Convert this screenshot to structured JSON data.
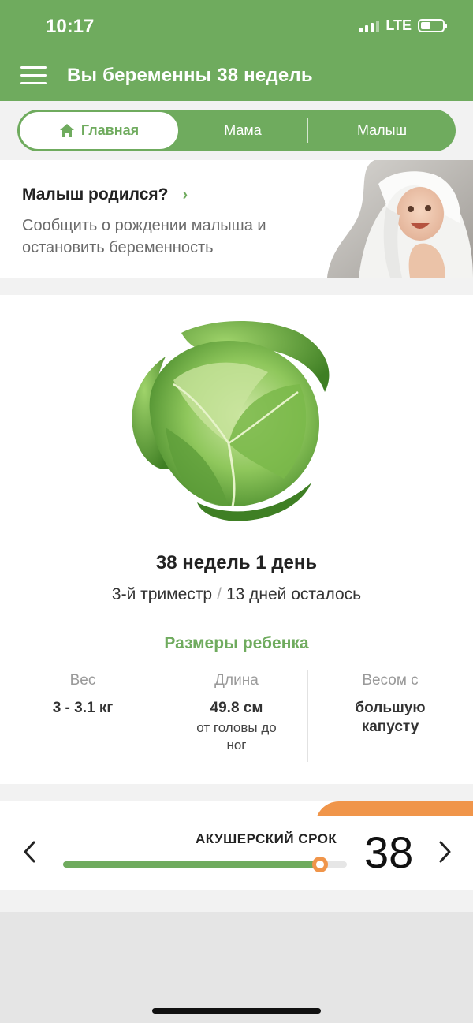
{
  "status": {
    "time": "10:17",
    "network": "LTE"
  },
  "header": {
    "title": "Вы беременны 38 недель"
  },
  "tabs": [
    {
      "label": "Главная",
      "active": true
    },
    {
      "label": "Мама",
      "active": false
    },
    {
      "label": "Малыш",
      "active": false
    }
  ],
  "born_card": {
    "title": "Малыш родился?",
    "subtitle": "Сообщить о рождении малыша и остановить беременность"
  },
  "main": {
    "week_title": "38 недель 1 день",
    "trimester": "3-й триместр",
    "days_left": "13 дней осталось",
    "sizes_title": "Размеры ребенка",
    "sizes": [
      {
        "label": "Вес",
        "value": "3 - 3.1 кг",
        "note": ""
      },
      {
        "label": "Длина",
        "value": "49.8 см",
        "note": "от головы до ног"
      },
      {
        "label": "Весом с",
        "value": "большую капусту",
        "note": ""
      }
    ]
  },
  "term": {
    "label": "АКУШЕРСКИЙ СРОК",
    "week": "38",
    "progress": 0.905
  },
  "colors": {
    "brand": "#6fab5e",
    "accent": "#f0954a"
  },
  "icons": [
    "menu-icon",
    "home-icon",
    "chevron-right-icon",
    "chevron-left-icon",
    "signal-icon",
    "battery-icon"
  ]
}
